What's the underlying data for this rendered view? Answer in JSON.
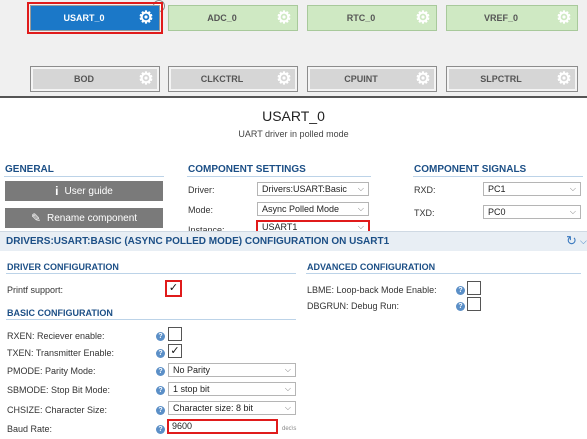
{
  "tiles_row1": [
    {
      "label": "USART_0",
      "style": "blue"
    },
    {
      "label": "ADC_0",
      "style": "green"
    },
    {
      "label": "RTC_0",
      "style": "green"
    },
    {
      "label": "VREF_0",
      "style": "green"
    }
  ],
  "tiles_row2": [
    {
      "label": "BOD",
      "style": "gray"
    },
    {
      "label": "CLKCTRL",
      "style": "gray"
    },
    {
      "label": "CPUINT",
      "style": "gray"
    },
    {
      "label": "SLPCTRL",
      "style": "gray"
    }
  ],
  "component": {
    "title": "USART_0",
    "subtitle": "UART driver in polled mode"
  },
  "general": {
    "heading": "GENERAL",
    "user_guide": "User guide",
    "rename": "Rename component"
  },
  "settings": {
    "heading": "COMPONENT SETTINGS",
    "driver_label": "Driver:",
    "driver_value": "Drivers:USART:Basic",
    "mode_label": "Mode:",
    "mode_value": "Async Polled Mode",
    "instance_label": "Instance:",
    "instance_value": "USART1"
  },
  "signals": {
    "heading": "COMPONENT SIGNALS",
    "rxd_label": "RXD:",
    "rxd_value": "PC1",
    "txd_label": "TXD:",
    "txd_value": "PC0"
  },
  "config": {
    "band_title": "DRIVERS:USART:BASIC (ASYNC POLLED MODE) CONFIGURATION ON USART1",
    "driver_heading": "DRIVER CONFIGURATION",
    "printf_label": "Printf support:",
    "printf_checked": "✓",
    "advanced_heading": "ADVANCED CONFIGURATION",
    "lbme_label": "LBME: Loop-back Mode Enable:",
    "dbgrun_label": "DBGRUN: Debug Run:",
    "basic_heading": "BASIC CONFIGURATION",
    "rxen_label": "RXEN: Reciever enable:",
    "txen_label": "TXEN: Transmitter Enable:",
    "txen_checked": "✓",
    "pmode_label": "PMODE: Parity Mode:",
    "pmode_value": "No Parity",
    "sbmode_label": "SBMODE: Stop Bit Mode:",
    "sbmode_value": "1 stop bit",
    "chsize_label": "CHSIZE: Character Size:",
    "chsize_value": "Character size: 8 bit",
    "baud_label": "Baud Rate:",
    "baud_value": "9600",
    "baud_unit": "dec\\s"
  },
  "icons": {
    "gear": "⚙",
    "help": "?",
    "book": "i",
    "pencil": "✎",
    "chevron": "⌵",
    "refresh": "↻"
  },
  "colors": {
    "accent_blue": "#1b78c8",
    "heading_blue": "#1c4f86",
    "highlight_red": "#e01b1b",
    "tile_green": "#cfe9c3"
  }
}
